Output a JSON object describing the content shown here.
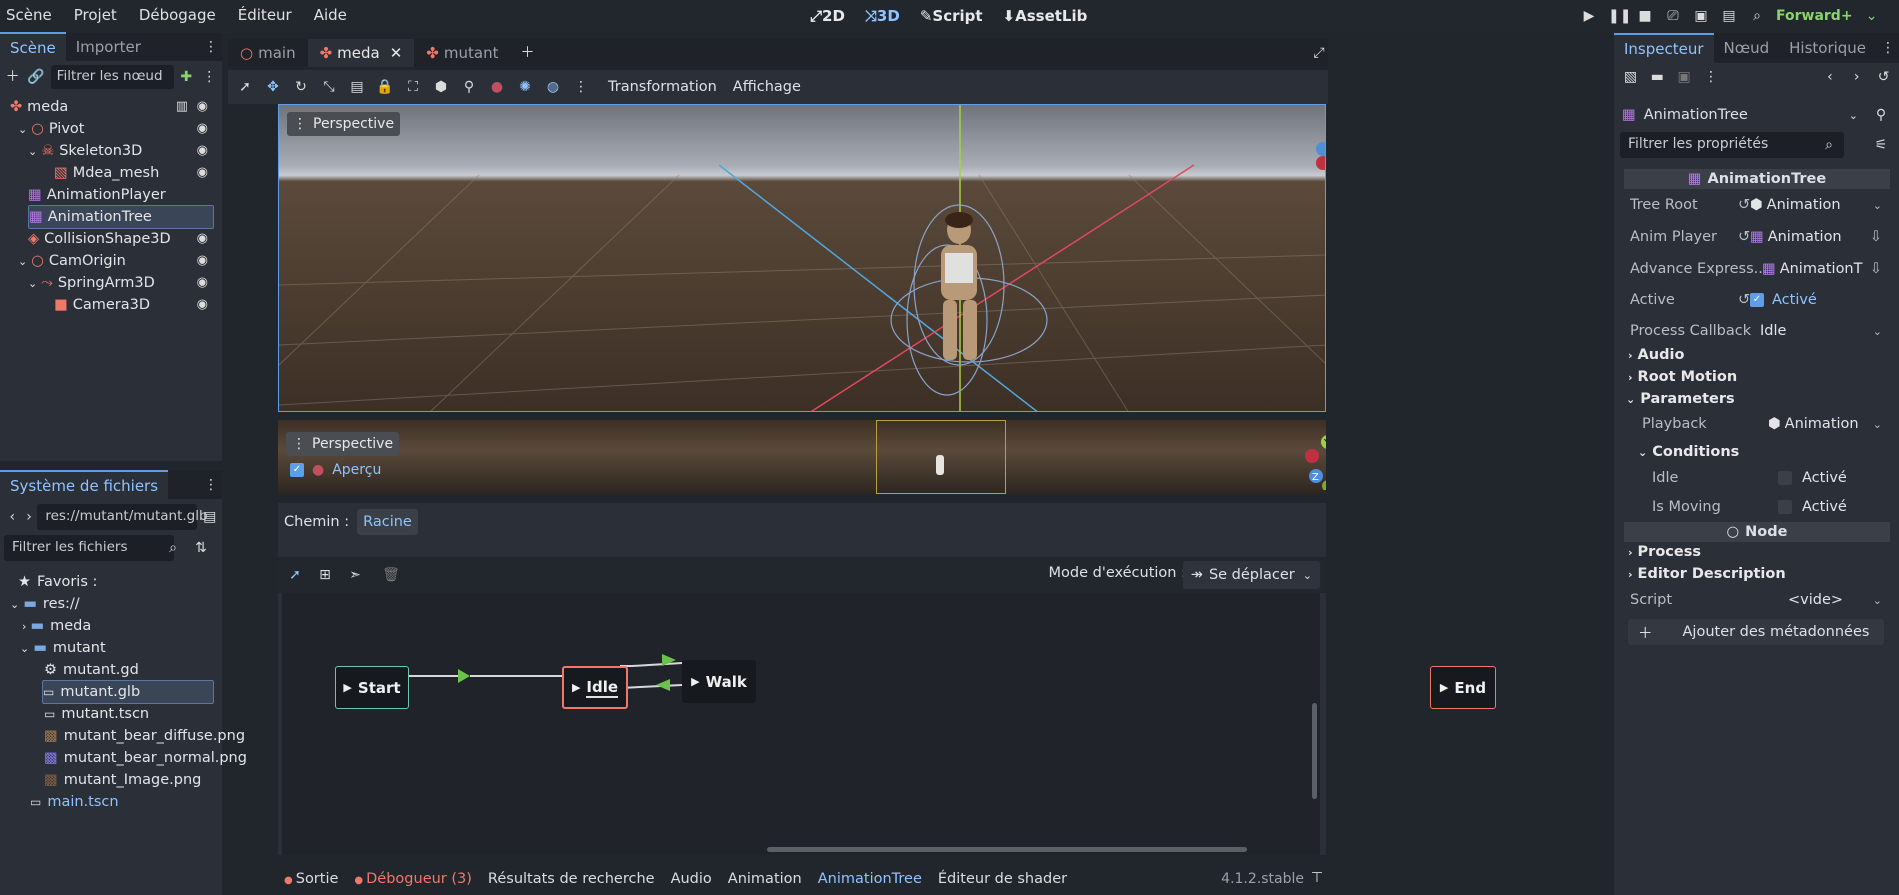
{
  "menu": [
    "Scène",
    "Projet",
    "Débogage",
    "Éditeur",
    "Aide"
  ],
  "modes": [
    "2D",
    "3D",
    "Script",
    "AssetLib"
  ],
  "renderer": "Forward+",
  "scene_tabs": [
    "Scène",
    "Importer"
  ],
  "scene_filter_placeholder": "Filtrer les nœud",
  "scene_tree": [
    "meda",
    "Pivot",
    "Skeleton3D",
    "Mdea_mesh",
    "AnimationPlayer",
    "AnimationTree",
    "CollisionShape3D",
    "CamOrigin",
    "SpringArm3D",
    "Camera3D"
  ],
  "fs_title": "Système de fichiers",
  "fs_path": "res://mutant/mutant.glb",
  "fs_filter_placeholder": "Filtrer les fichiers",
  "fs_items": [
    "Favoris :",
    "res://",
    "meda",
    "mutant",
    "mutant.gd",
    "mutant.glb",
    "mutant.tscn",
    "mutant_bear_diffuse.png",
    "mutant_bear_normal.png",
    "mutant_Image.png",
    "main.tscn"
  ],
  "editor_tabs": [
    "main",
    "meda",
    "mutant"
  ],
  "toolbar_menus": [
    "Transformation",
    "Affichage"
  ],
  "viewport_label": "Perspective",
  "preview_label": "Perspective",
  "preview_check": "Aperçu",
  "path_label": "Chemin :",
  "path_root": "Racine",
  "mode_label": "Mode d'exécution :",
  "mode_value": "Se déplacer",
  "nodes": [
    "Start",
    "Idle",
    "Walk",
    "End"
  ],
  "bottom_tabs": [
    "Sortie",
    "Débogueur (3)",
    "Résultats de recherche",
    "Audio",
    "Animation",
    "AnimationTree",
    "Éditeur de shader"
  ],
  "version": "4.1.2.stable",
  "insp_tabs": [
    "Inspecteur",
    "Nœud",
    "Historique"
  ],
  "insp_object": "AnimationTree",
  "insp_filter_placeholder": "Filtrer les propriétés",
  "insp_header": "AnimationTree",
  "props": [
    {
      "k": "Tree Root",
      "v": "Animation"
    },
    {
      "k": "Anim Player",
      "v": "Animation"
    },
    {
      "k": "Advance Express...",
      "v": "AnimationT"
    },
    {
      "k": "Active",
      "v": "Activé"
    },
    {
      "k": "Process Callback",
      "v": "Idle"
    }
  ],
  "sections": [
    "Audio",
    "Root Motion",
    "Parameters"
  ],
  "playback": {
    "k": "Playback",
    "v": "Animation"
  },
  "conditions_title": "Conditions",
  "conditions": [
    {
      "k": "Idle",
      "v": "Activé"
    },
    {
      "k": "Is Moving",
      "v": "Activé"
    }
  ],
  "node_header": "Node",
  "sections2": [
    "Process",
    "Editor Description"
  ],
  "script": {
    "k": "Script",
    "v": "<vide>"
  },
  "add_meta": "Ajouter des métadonnées"
}
